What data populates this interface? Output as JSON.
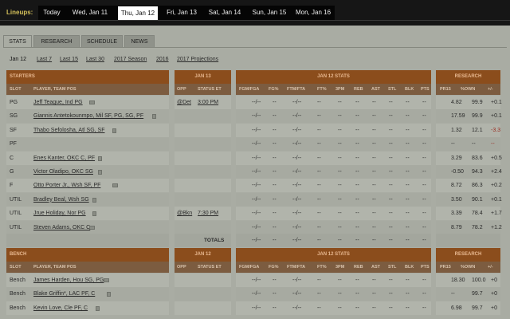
{
  "lineups": {
    "label": "Lineups:",
    "days": [
      "Today",
      "Wed, Jan 11",
      "Thu, Jan 12",
      "Fri, Jan 13",
      "Sat, Jan 14",
      "Sun, Jan 15",
      "Mon, Jan 16"
    ],
    "active_index": 2
  },
  "tabs": [
    "STATS",
    "RESEARCH",
    "SCHEDULE",
    "NEWS"
  ],
  "active_tab": 0,
  "periods": [
    "Jan 12",
    "Last 7",
    "Last 15",
    "Last 30",
    "2017 Season",
    "2016",
    "2017 Projections"
  ],
  "starters_header": {
    "section": "STARTERS",
    "date": "JAN 13",
    "stats": "JAN 12 STATS",
    "research": "RESEARCH",
    "cols": [
      "SLOT",
      "PLAYER, TEAM POS",
      "OPP",
      "STATUS ET",
      "FGM/FGA",
      "FG%",
      "FTM/FTA",
      "FT%",
      "3PM",
      "REB",
      "AST",
      "STL",
      "BLK",
      "PTS",
      "PR15",
      "%OWN",
      "+/-"
    ]
  },
  "starters": [
    {
      "slot": "PG",
      "player": "Jeff Teague, Ind PG",
      "opp": "@Det",
      "status": "3:00 PM",
      "fgm": "--/--",
      "fgp": "--",
      "ftm": "--/--",
      "ftp": "--",
      "tpm": "--",
      "reb": "--",
      "ast": "--",
      "stl": "--",
      "blk": "--",
      "pts": "--",
      "pr15": "4.82",
      "own": "99.9",
      "pm": "+0.1"
    },
    {
      "slot": "SG",
      "player": "Giannis Antetokounmpo, Mil SF, PG, SG, PF",
      "opp": "",
      "status": "",
      "fgm": "--/--",
      "fgp": "--",
      "ftm": "--/--",
      "ftp": "--",
      "tpm": "--",
      "reb": "--",
      "ast": "--",
      "stl": "--",
      "blk": "--",
      "pts": "--",
      "pr15": "17.59",
      "own": "99.9",
      "pm": "+0.1"
    },
    {
      "slot": "SF",
      "player": "Thabo Sefolosha, Atl SG, SF",
      "opp": "",
      "status": "",
      "fgm": "--/--",
      "fgp": "--",
      "ftm": "--/--",
      "ftp": "--",
      "tpm": "--",
      "reb": "--",
      "ast": "--",
      "stl": "--",
      "blk": "--",
      "pts": "--",
      "pr15": "1.32",
      "own": "12.1",
      "pm": "-3.3"
    },
    {
      "slot": "PF",
      "player": "",
      "opp": "",
      "status": "",
      "fgm": "--/--",
      "fgp": "--",
      "ftm": "--/--",
      "ftp": "--",
      "tpm": "--",
      "reb": "--",
      "ast": "--",
      "stl": "--",
      "blk": "--",
      "pts": "--",
      "pr15": "--",
      "own": "--",
      "pm": "--"
    },
    {
      "slot": "C",
      "player": "Enes Kanter, OKC C, PF",
      "opp": "",
      "status": "",
      "fgm": "--/--",
      "fgp": "--",
      "ftm": "--/--",
      "ftp": "--",
      "tpm": "--",
      "reb": "--",
      "ast": "--",
      "stl": "--",
      "blk": "--",
      "pts": "--",
      "pr15": "3.29",
      "own": "83.6",
      "pm": "+0.5"
    },
    {
      "slot": "G",
      "player": "Victor Oladipo, OKC SG",
      "opp": "",
      "status": "",
      "fgm": "--/--",
      "fgp": "--",
      "ftm": "--/--",
      "ftp": "--",
      "tpm": "--",
      "reb": "--",
      "ast": "--",
      "stl": "--",
      "blk": "--",
      "pts": "--",
      "pr15": "-0.50",
      "own": "94.3",
      "pm": "+2.4"
    },
    {
      "slot": "F",
      "player": "Otto Porter Jr., Wsh SF, PF",
      "opp": "",
      "status": "",
      "fgm": "--/--",
      "fgp": "--",
      "ftm": "--/--",
      "ftp": "--",
      "tpm": "--",
      "reb": "--",
      "ast": "--",
      "stl": "--",
      "blk": "--",
      "pts": "--",
      "pr15": "8.72",
      "own": "86.3",
      "pm": "+0.2"
    },
    {
      "slot": "UTIL",
      "player": "Bradley Beal, Wsh SG",
      "opp": "",
      "status": "",
      "fgm": "--/--",
      "fgp": "--",
      "ftm": "--/--",
      "ftp": "--",
      "tpm": "--",
      "reb": "--",
      "ast": "--",
      "stl": "--",
      "blk": "--",
      "pts": "--",
      "pr15": "3.50",
      "own": "90.1",
      "pm": "+0.1"
    },
    {
      "slot": "UTIL",
      "player": "Jrue Holiday, Nor PG",
      "opp": "@Bkn",
      "status": "7:30 PM",
      "fgm": "--/--",
      "fgp": "--",
      "ftm": "--/--",
      "ftp": "--",
      "tpm": "--",
      "reb": "--",
      "ast": "--",
      "stl": "--",
      "blk": "--",
      "pts": "--",
      "pr15": "3.39",
      "own": "78.4",
      "pm": "+1.7"
    },
    {
      "slot": "UTIL",
      "player": "Steven Adams, OKC C",
      "opp": "",
      "status": "",
      "fgm": "--/--",
      "fgp": "--",
      "ftm": "--/--",
      "ftp": "--",
      "tpm": "--",
      "reb": "--",
      "ast": "--",
      "stl": "--",
      "blk": "--",
      "pts": "--",
      "pr15": "8.79",
      "own": "78.2",
      "pm": "+1.2"
    }
  ],
  "totals": {
    "label": "TOTALS",
    "fgm": "--/--",
    "fgp": "--",
    "ftm": "--/--",
    "ftp": "--",
    "tpm": "--",
    "reb": "--",
    "ast": "--",
    "stl": "--",
    "blk": "--",
    "pts": "--"
  },
  "bench_header": {
    "section": "BENCH",
    "date": "JAN 12",
    "stats": "JAN 12 STATS",
    "research": "RESEARCH",
    "cols": [
      "SLOT",
      "PLAYER, TEAM POS",
      "OPP",
      "STATUS ET",
      "FGM/FGA",
      "FG%",
      "FTM/FTA",
      "FT%",
      "3PM",
      "REB",
      "AST",
      "STL",
      "BLK",
      "PTS",
      "PR15",
      "%OWN",
      "+/-"
    ]
  },
  "bench": [
    {
      "slot": "Bench",
      "player": "James Harden, Hou SG, PG",
      "opp": "",
      "status": "",
      "fgm": "--/--",
      "fgp": "--",
      "ftm": "--/--",
      "ftp": "--",
      "tpm": "--",
      "reb": "--",
      "ast": "--",
      "stl": "--",
      "blk": "--",
      "pts": "--",
      "pr15": "18.30",
      "own": "100.0",
      "pm": "+0"
    },
    {
      "slot": "Bench",
      "player": "Blake Griffin*, LAC PF, C",
      "opp": "",
      "status": "",
      "fgm": "--/--",
      "fgp": "--",
      "ftm": "--/--",
      "ftp": "--",
      "tpm": "--",
      "reb": "--",
      "ast": "--",
      "stl": "--",
      "blk": "--",
      "pts": "--",
      "pr15": "--",
      "own": "99.7",
      "pm": "+0"
    },
    {
      "slot": "Bench",
      "player": "Kevin Love, Cle PF, C",
      "opp": "",
      "status": "",
      "fgm": "--/--",
      "fgp": "--",
      "ftm": "--/--",
      "ftp": "--",
      "tpm": "--",
      "reb": "--",
      "ast": "--",
      "stl": "--",
      "blk": "--",
      "pts": "--",
      "pr15": "6.98",
      "own": "99.7",
      "pm": "+0"
    }
  ],
  "colors": {
    "header_orange": "#8b4d1c",
    "header_brown": "#7c5c40",
    "negative": "#9a2b1f",
    "nav_bg": "#161616"
  }
}
